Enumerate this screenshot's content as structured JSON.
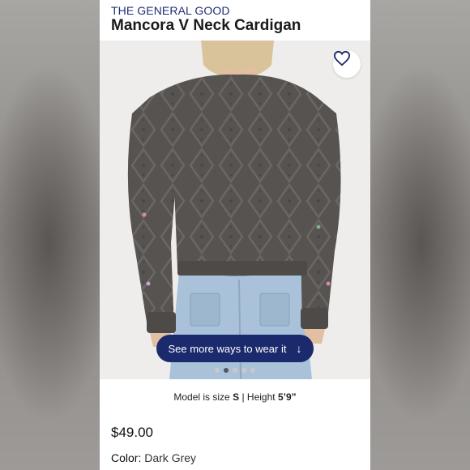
{
  "product": {
    "brand": "THE GENERAL GOOD",
    "name": "Mancora V Neck Cardigan",
    "price": "$49.00",
    "color_label": "Color:",
    "color_value": "Dark Grey"
  },
  "gallery": {
    "cta_label": "See more ways to wear it",
    "cta_icon": "arrow-down-icon",
    "favorite_icon": "heart-icon",
    "dots_count": 5,
    "active_dot": 1
  },
  "model_info": {
    "size_prefix": "Model is size",
    "size": "S",
    "separator": "|",
    "height_prefix": "Height",
    "height": "5’9”"
  },
  "colors": {
    "brand": "#1f2d74",
    "cta_bg": "#1a2a6c",
    "sweater": "#575350",
    "denim": "#a9c2da"
  }
}
